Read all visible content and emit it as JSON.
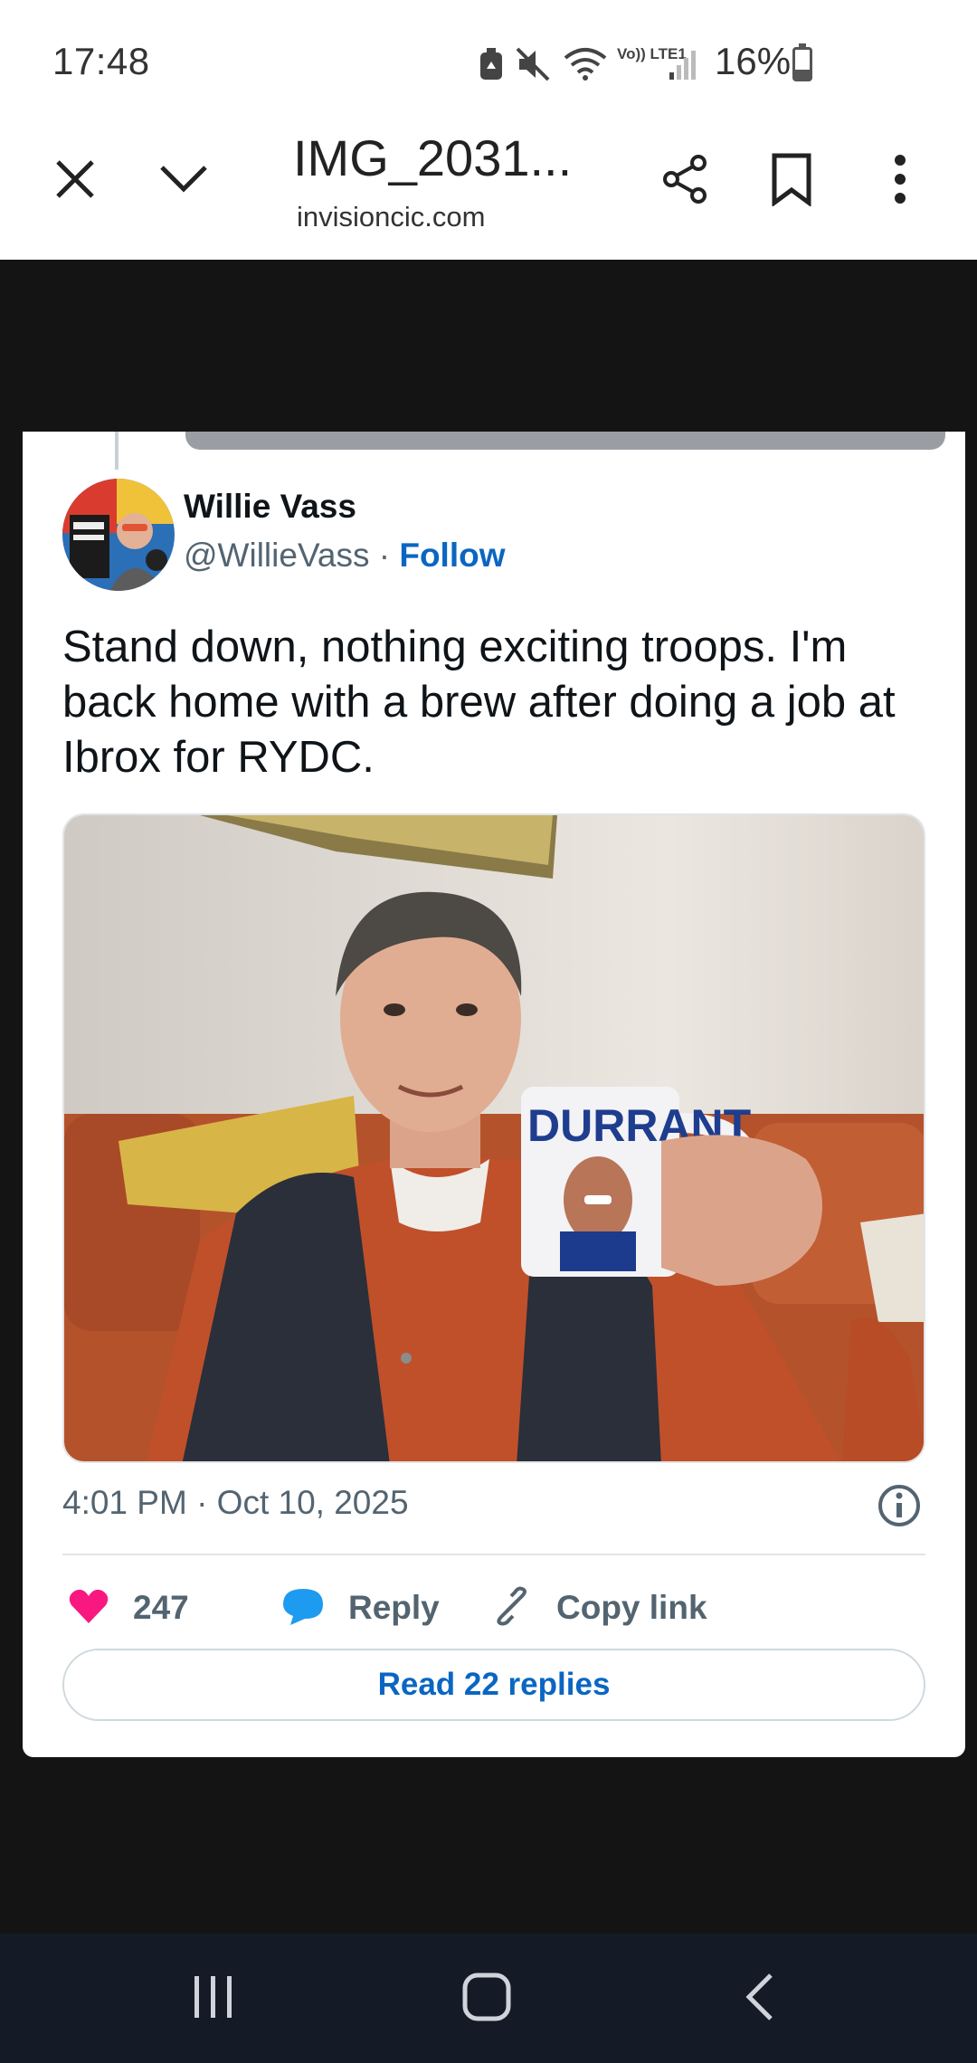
{
  "status_bar": {
    "time": "17:48",
    "battery_pct": "16%",
    "network_label": "Vo)) LTE1",
    "icons": [
      "battery-saver-icon",
      "mute-icon",
      "wifi-icon",
      "volte-icon",
      "signal-icon",
      "battery-charging-icon"
    ]
  },
  "browser": {
    "title": "IMG_2031...",
    "url": "invisioncic.com",
    "buttons": [
      "close-icon",
      "chevron-down-icon",
      "share-icon",
      "bookmark-icon",
      "more-vert-icon"
    ]
  },
  "tweet": {
    "author_name": "Willie Vass",
    "handle": "@WillieVass",
    "separator": "·",
    "follow_label": "Follow",
    "text": "Stand down, nothing exciting troops. I'm back home with a brew after doing a job at Ibrox for RYDC.",
    "mug_text": "DURRANT",
    "timestamp": "4:01 PM · Oct 10, 2025",
    "likes": "247",
    "reply_label": "Reply",
    "copy_link_label": "Copy link",
    "read_replies_label": "Read 22 replies"
  },
  "colors": {
    "like": "#f91880",
    "reply_bubble": "#1d9bf0",
    "link_blue": "#0a66c2",
    "navbar": "#141b27"
  },
  "navbar": {
    "buttons": [
      "recents-icon",
      "home-icon",
      "back-icon"
    ]
  }
}
